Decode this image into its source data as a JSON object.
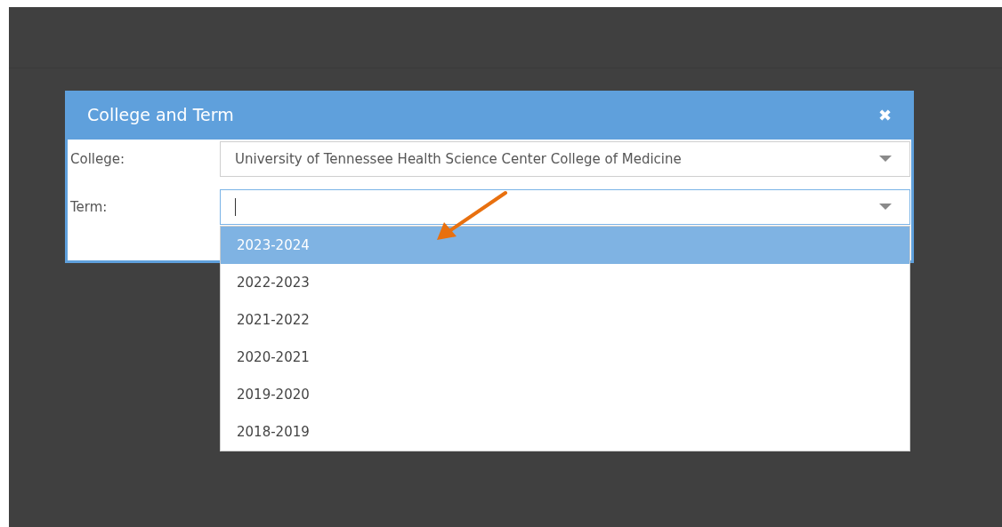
{
  "dialog": {
    "title": "College and Term",
    "close_label": "✖",
    "fields": [
      {
        "label": "College:",
        "value": "University of Tennessee Health Science Center College of Medicine",
        "focused": false
      },
      {
        "label": "Term:",
        "focused": true
      }
    ]
  },
  "term_options": [
    {
      "label": "2023-2024",
      "selected": true
    },
    {
      "label": "2022-2023",
      "selected": false
    },
    {
      "label": "2021-2022",
      "selected": false
    },
    {
      "label": "2020-2021",
      "selected": false
    },
    {
      "label": "2019-2020",
      "selected": false
    },
    {
      "label": "2018-2019",
      "selected": false
    }
  ]
}
